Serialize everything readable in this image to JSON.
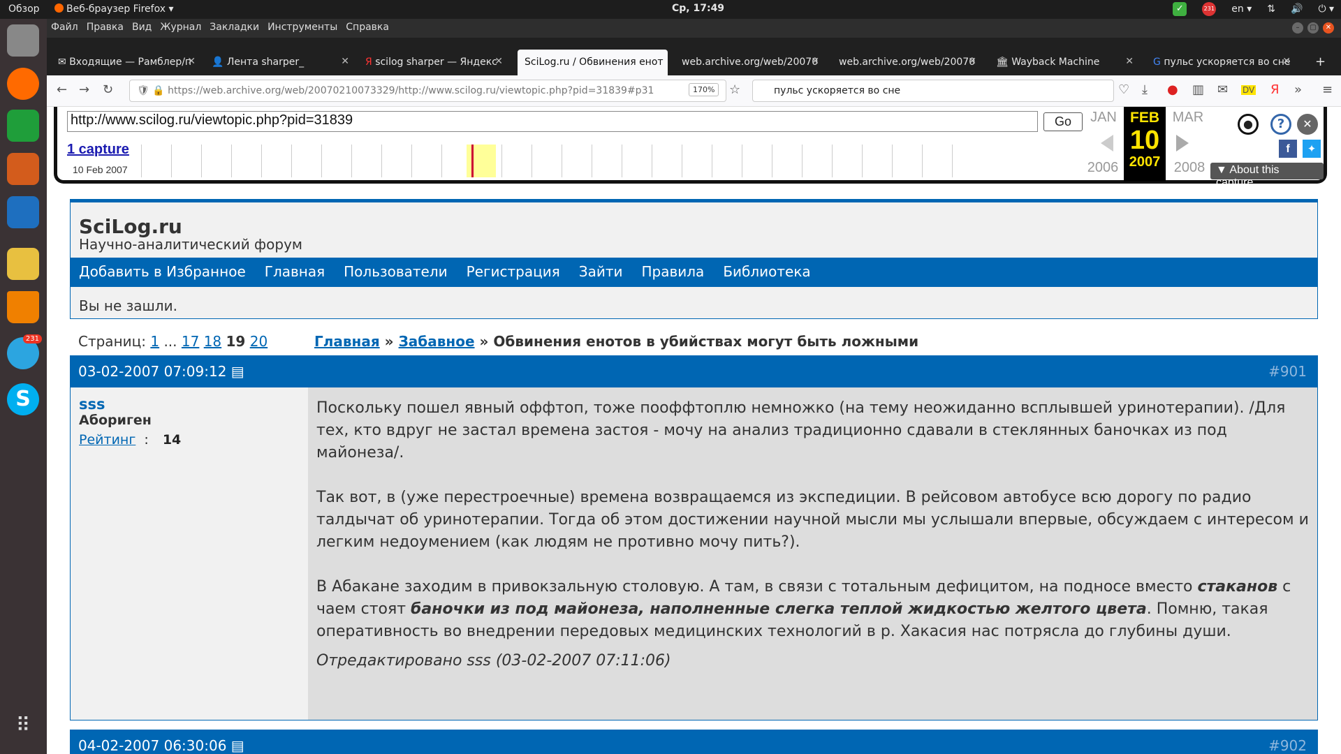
{
  "desktop": {
    "activities": "Обзор",
    "app": "Веб-браузер Firefox ▾",
    "clock": "Ср, 17:49",
    "lang": "en ▾",
    "tg_badge": "231"
  },
  "menu": [
    "Файл",
    "Правка",
    "Вид",
    "Журнал",
    "Закладки",
    "Инструменты",
    "Справка"
  ],
  "tabs": [
    "Входящие — Рамблер/п",
    "Лента sharper_",
    "scilog sharper — Яндекс",
    "SciLog.ru / Обвинения енот",
    "web.archive.org/web/20070",
    "web.archive.org/web/20070",
    "Wayback Machine",
    "пульс ускоряется во сне"
  ],
  "nav": {
    "url": "https://web.archive.org/web/20070210073329/http://www.scilog.ru/viewtopic.php?pid=31839#p31",
    "zoom": "170%",
    "search": "пульс ускоряется во сне"
  },
  "wayback": {
    "url": "http://www.scilog.ru/viewtopic.php?pid=31839",
    "go": "Go",
    "captures": "1 capture",
    "capture_date": "10 Feb 2007",
    "prev_month": "JAN",
    "cur_month": "FEB",
    "next_month": "MAR",
    "day": "10",
    "prev_year": "2006",
    "cur_year": "2007",
    "next_year": "2008",
    "about": "▼ About this capture"
  },
  "forum": {
    "title": "SciLog.ru",
    "subtitle": "Научно-аналитический форум",
    "nav": [
      "Добавить в Избранное",
      "Главная",
      "Пользователи",
      "Регистрация",
      "Зайти",
      "Правила",
      "Библиотека"
    ],
    "status": "Вы не зашли."
  },
  "pagination": {
    "label": "Страниц:",
    "p1": "1",
    "dots": "...",
    "p17": "17",
    "p18": "18",
    "p19": "19",
    "p20": "20"
  },
  "breadcrumb": {
    "home": "Главная",
    "sep": "»",
    "section": "Забавное",
    "topic": "Обвинения енотов в убийствах могут быть ложными"
  },
  "post1": {
    "date": "03-02-2007 07:09:12",
    "num": "#901",
    "author": "sss",
    "rank": "Абориген",
    "rating_label": "Рейтинг",
    "colon": ":",
    "rating": "14",
    "p1": "Поскольку пошел явный оффтоп, тоже пооффтоплю немножко (на тему неожиданно всплывшей уринотерапии). /Для тех, кто вдруг не застал времена застоя - мочу на анализ традиционно сдавали в стеклянных баночках из под майонеза/.",
    "p2": "Так вот, в (уже перестроечные) времена возвращаемся из экспедиции. В рейсовом автобусе всю дорогу по радио талдычат об уринотерапии. Тогда об этом достижении научной мысли мы услышали впервые, обсуждаем с интересом и легким недоумением (как людям не противно мочу пить?).",
    "p3a": "В Абакане заходим в привокзальную столовую. А там, в связи с тотальным дефицитом, на подносе вместо ",
    "p3b": "стаканов",
    "p3c": " с чаем стоят ",
    "p3d": "баночки из под майонеза, наполненные слегка теплой жидкостью желтого цвета",
    "p3e": ". Помню, такая оперативность во внедрении передовых медицинских технологий в р. Хакасия нас потрясла до глубины души.",
    "edited": "Отредактировано sss (03-02-2007 07:11:06)"
  },
  "post2": {
    "date": "04-02-2007 06:30:06",
    "num": "#902"
  }
}
